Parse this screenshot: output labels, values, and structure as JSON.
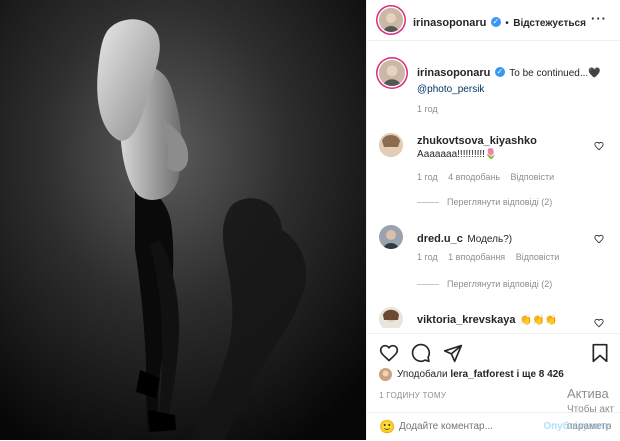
{
  "header": {
    "username": "irinasoponaru",
    "verified_mark": "✓",
    "separator": "•",
    "follow_status": "Відстежується",
    "more_label": "···"
  },
  "caption": {
    "username": "irinasoponaru",
    "text": "To be continued...🖤",
    "mention": "@photo_persik",
    "time": "1 год"
  },
  "comments": [
    {
      "username": "zhukovtsova_kiyashko",
      "text": "Ааааааа!!!!!!!!!!🌷",
      "time": "1 год",
      "likes": "4 вподобань",
      "reply": "Відповісти",
      "view_replies": "Переглянути відповіді (2)"
    },
    {
      "username": "dred.u_c",
      "text": "Модель?)",
      "time": "1 год",
      "likes": "1 вподобання",
      "reply": "Відповісти",
      "view_replies": "Переглянути відповіді (2)"
    },
    {
      "username": "viktoria_krevskaya",
      "text": "👏👏👏"
    }
  ],
  "likes": {
    "prefix": "Уподобали",
    "user": "lera_fatforest",
    "suffix": "і ще 8 426"
  },
  "time_ago": "1 ГОДИНУ ТОМУ",
  "add_comment": {
    "placeholder": "Додайте коментар...",
    "emoji_icon": "🙂",
    "post_label": "Опублікувати"
  },
  "watermark": {
    "line1": "Актива",
    "line2": "Чтобы акт",
    "line3": "параметр"
  },
  "icons": {
    "heart": "heart-icon",
    "comment": "comment-icon",
    "share": "share-icon",
    "bookmark": "bookmark-icon"
  },
  "colors": {
    "verified": "#3897f0",
    "link_post": "#b2dffc",
    "text": "#262626",
    "muted": "#8e8e8e"
  }
}
